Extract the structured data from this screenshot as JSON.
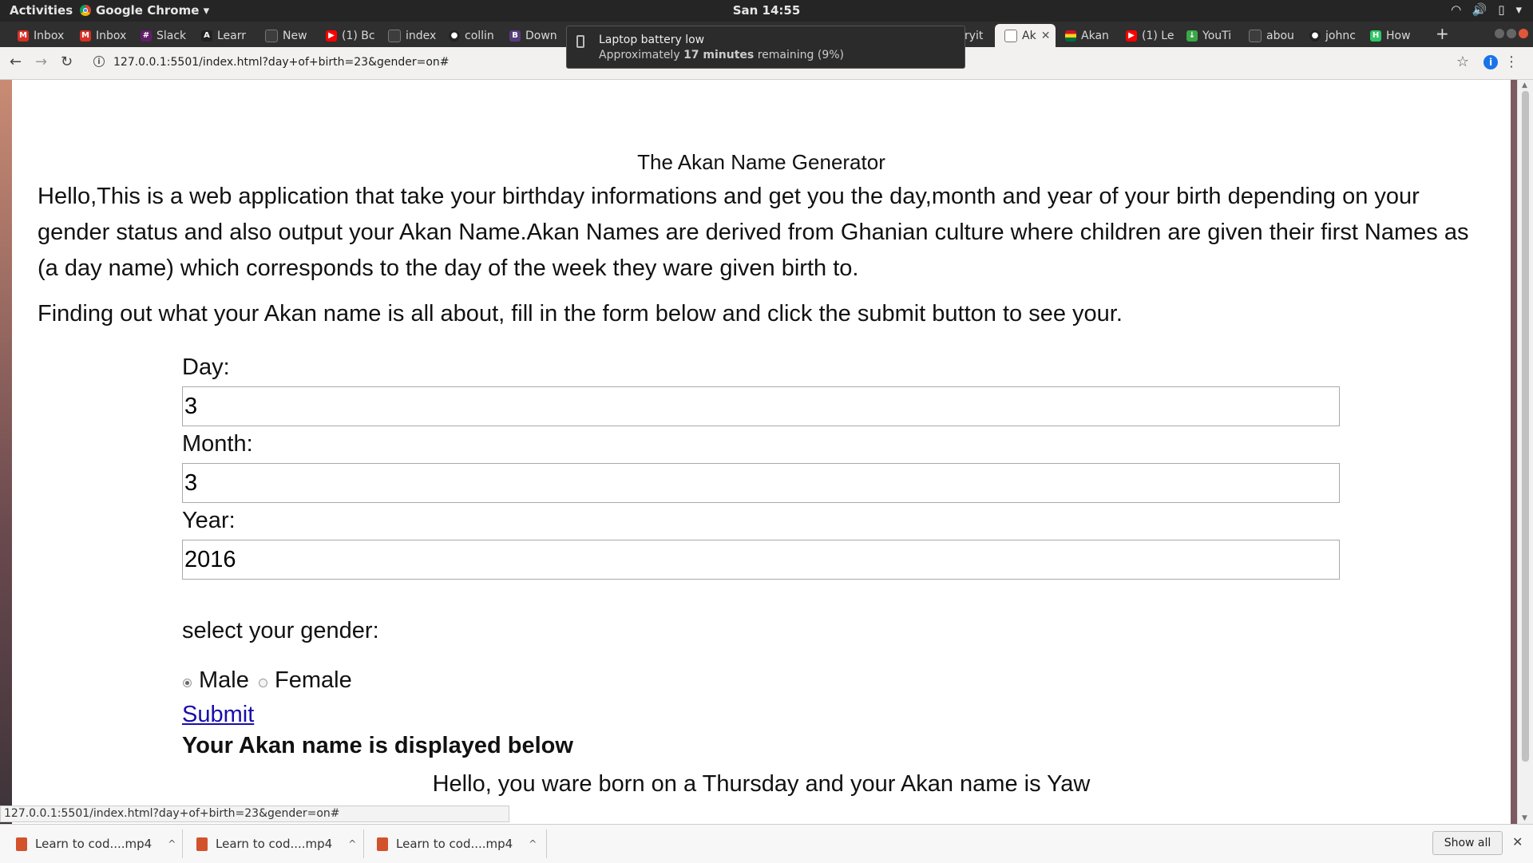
{
  "topbar": {
    "activities": "Activities",
    "app_name": "Google Chrome ▾",
    "clock": "San 14:55"
  },
  "tabs": [
    {
      "label": "Inbox",
      "icon": "gmail-icon",
      "color": "#d93025"
    },
    {
      "label": "Inbox",
      "icon": "gmail-icon",
      "color": "#d93025"
    },
    {
      "label": "Slack",
      "icon": "slack-icon",
      "color": "#611f69"
    },
    {
      "label": "Learr",
      "icon": "angular-icon",
      "color": "#222222"
    },
    {
      "label": "New",
      "icon": "page-icon",
      "color": "#555555"
    },
    {
      "label": "(1) Bc",
      "icon": "youtube-icon",
      "color": "#ff0000"
    },
    {
      "label": "index",
      "icon": "page-icon",
      "color": "#555555"
    },
    {
      "label": "collin",
      "icon": "github-icon",
      "color": "#222222"
    },
    {
      "label": "Down",
      "icon": "bootstrap-icon",
      "color": "#563d7c"
    },
    {
      "label": "ryit",
      "icon": "page-icon",
      "color": "#555555"
    },
    {
      "label": "Ak",
      "icon": "page-icon",
      "color": "#777777",
      "active": true
    },
    {
      "label": "Akan",
      "icon": "ghana-flag-icon",
      "color": "#ce1126"
    },
    {
      "label": "(1) Le",
      "icon": "youtube-icon",
      "color": "#ff0000"
    },
    {
      "label": "YouTi",
      "icon": "download-icon",
      "color": "#3aa846"
    },
    {
      "label": "abou",
      "icon": "page-icon",
      "color": "#555555"
    },
    {
      "label": "johnc",
      "icon": "github-icon",
      "color": "#222222"
    },
    {
      "label": "How",
      "icon": "hackerrank-icon",
      "color": "#2ec866"
    }
  ],
  "notification": {
    "title": "Laptop battery low",
    "line_prefix": "Approximately ",
    "line_bold": "17 minutes",
    "line_suffix": " remaining (9%)"
  },
  "browser": {
    "url": "127.0.0.1:5501/index.html?day+of+birth=23&gender=on#"
  },
  "page": {
    "title": "The Akan Name Generator",
    "intro": "Hello,This is a web application that take your birthday informations and get you the day,month and year of your birth depending on your gender status and also output your Akan Name.Akan Names are derived from Ghanian culture where children are given their first Names as (a day name) which corresponds to the day of the week they ware given birth to.",
    "instruction": "Finding out what your Akan name is all about, fill in the form below and click the submit button to see your.",
    "form": {
      "day_label": "Day:",
      "day_value": "3",
      "month_label": "Month:",
      "month_value": "3",
      "year_label": "Year:",
      "year_value": "2016",
      "gender_label": "select your gender:",
      "male_label": "Male",
      "female_label": "Female",
      "selected_gender": "Male",
      "submit_label": "Submit"
    },
    "result_heading": "Your Akan name is displayed below",
    "result_text": "Hello, you ware born on a Thursday and your Akan name is Yaw"
  },
  "statusbar": {
    "text": "127.0.0.1:5501/index.html?day+of+birth=23&gender=on#"
  },
  "downloads": {
    "items": [
      "Learn to cod....mp4",
      "Learn to cod....mp4",
      "Learn to cod....mp4"
    ],
    "show_all": "Show all"
  }
}
